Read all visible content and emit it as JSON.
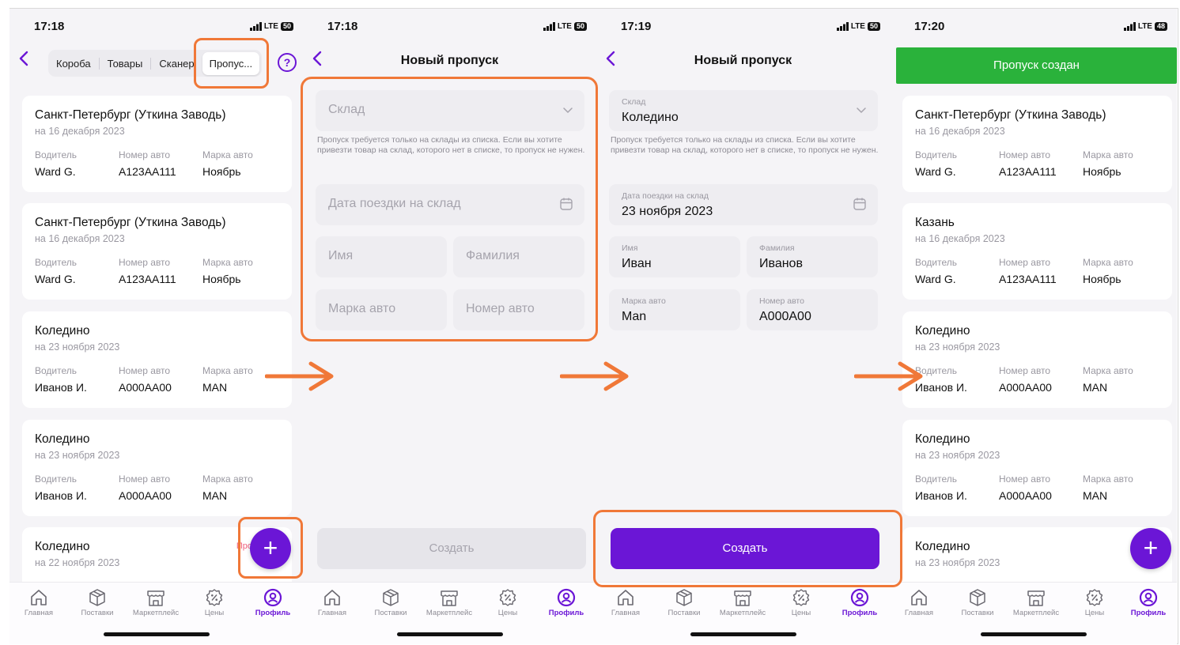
{
  "colors": {
    "accent": "#6b16d6",
    "success": "#2ab23b",
    "highlight": "#f07838",
    "arrow": "#f07838"
  },
  "status_icons": {
    "network": "LTE"
  },
  "tabbar": [
    {
      "label": "Главная",
      "icon": "home-icon"
    },
    {
      "label": "Поставки",
      "icon": "box-icon"
    },
    {
      "label": "Маркетплейс",
      "icon": "store-icon"
    },
    {
      "label": "Цены",
      "icon": "percent-icon"
    },
    {
      "label": "Профиль",
      "icon": "profile-icon",
      "active": true
    }
  ],
  "card_labels": {
    "driver": "Водитель",
    "car_number": "Номер авто",
    "car_brand": "Марка авто"
  },
  "screen1": {
    "time": "17:18",
    "battery": "50",
    "tabs": [
      "Короба",
      "Товары",
      "Сканер",
      "Пропус..."
    ],
    "help_icon": "?",
    "cards": [
      {
        "city": "Санкт-Петербург (Уткина Заводь)",
        "date": "на 16 декабря 2023",
        "driver": "Ward G.",
        "number": "А123АА111",
        "brand": "Ноябрь"
      },
      {
        "city": "Санкт-Петербург (Уткина Заводь)",
        "date": "на 16 декабря 2023",
        "driver": "Ward G.",
        "number": "А123АА111",
        "brand": "Ноябрь"
      },
      {
        "city": "Коледино",
        "date": "на 23 ноября 2023",
        "driver": "Иванов И.",
        "number": "А000АА00",
        "brand": "MAN"
      },
      {
        "city": "Коледино",
        "date": "на 23 ноября 2023",
        "driver": "Иванов И.",
        "number": "А000АА00",
        "brand": "MAN"
      },
      {
        "city": "Коледино",
        "date": "на 22 ноября 2023",
        "badge": "Про"
      }
    ],
    "fab": "+"
  },
  "screen2": {
    "time": "17:18",
    "battery": "50",
    "title": "Новый пропуск",
    "warehouse_placeholder": "Склад",
    "hint": "Пропуск требуется только на склады из списка. Если вы хотите привезти товар на склад, которого нет в списке, то пропуск не нужен.",
    "date_placeholder": "Дата поездки на склад",
    "name_placeholder": "Имя",
    "surname_placeholder": "Фамилия",
    "brand_placeholder": "Марка авто",
    "number_placeholder": "Номер авто",
    "create_label": "Создать"
  },
  "screen3": {
    "time": "17:19",
    "battery": "50",
    "title": "Новый пропуск",
    "warehouse_label": "Склад",
    "warehouse_value": "Коледино",
    "hint": "Пропуск требуется только на склады из списка. Если вы хотите привезти товар на склад, которого нет в списке, то пропуск не нужен.",
    "date_label": "Дата поездки на склад",
    "date_value": "23 ноября 2023",
    "name_label": "Имя",
    "name_value": "Иван",
    "surname_label": "Фамилия",
    "surname_value": "Иванов",
    "brand_label": "Марка авто",
    "brand_value": "Man",
    "number_label": "Номер авто",
    "number_value": "А000А00",
    "create_label": "Создать"
  },
  "screen4": {
    "time": "17:20",
    "battery": "48",
    "toast": "Пропуск создан",
    "cards": [
      {
        "city": "Санкт-Петербург (Уткина Заводь)",
        "date": "на 16 декабря 2023",
        "driver": "Ward G.",
        "number": "А123АА111",
        "brand": "Ноябрь"
      },
      {
        "city": "Казань",
        "date": "на 16 декабря 2023",
        "driver": "Ward G.",
        "number": "А123АА111",
        "brand": "Ноябрь"
      },
      {
        "city": "Коледино",
        "date": "на 23 ноября 2023",
        "driver": "Иванов И.",
        "number": "А000АА00",
        "brand": "MAN"
      },
      {
        "city": "Коледино",
        "date": "на 23 ноября 2023",
        "driver": "Иванов И.",
        "number": "А000АА00",
        "brand": "MAN"
      },
      {
        "city": "Коледино",
        "date": "на 23 ноября 2023"
      }
    ],
    "fab": "+"
  }
}
